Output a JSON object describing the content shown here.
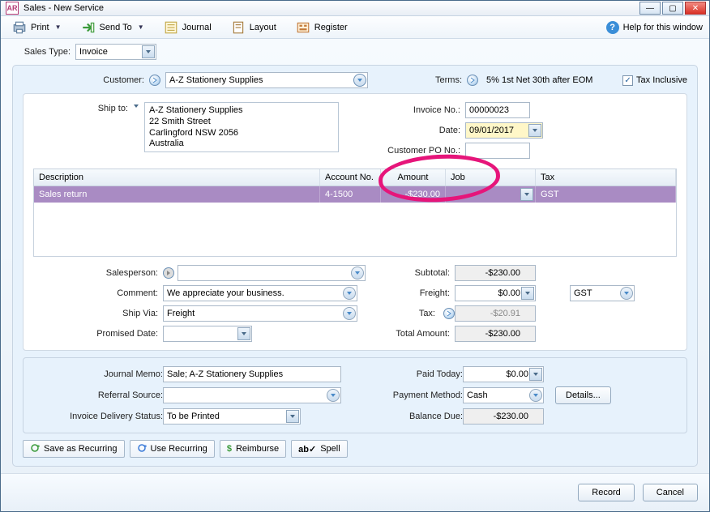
{
  "window": {
    "title": "Sales - New Service",
    "app_abbrev": "AR"
  },
  "toolbar": {
    "print": "Print",
    "sendto": "Send To",
    "journal": "Journal",
    "layout": "Layout",
    "register": "Register",
    "help": "Help for this window"
  },
  "sales_type": {
    "label": "Sales Type:",
    "value": "Invoice"
  },
  "header": {
    "customer_label": "Customer:",
    "customer_value": "A-Z Stationery Supplies",
    "terms_label": "Terms:",
    "terms_value": "5% 1st Net 30th after EOM",
    "tax_inclusive_label": "Tax Inclusive",
    "tax_inclusive_checked": true,
    "ship_to_label": "Ship to:",
    "ship_to_value": "A-Z Stationery Supplies\n22 Smith Street\nCarlingford  NSW  2056\nAustralia",
    "invoice_no_label": "Invoice No.:",
    "invoice_no_value": "00000023",
    "date_label": "Date:",
    "date_value": "09/01/2017",
    "po_label": "Customer PO No.:",
    "po_value": ""
  },
  "grid": {
    "columns": {
      "description": "Description",
      "account": "Account No.",
      "amount": "Amount",
      "job": "Job",
      "tax": "Tax"
    },
    "rows": [
      {
        "description": "Sales return",
        "account": "4-1500",
        "amount": "-$230.00",
        "job": "",
        "tax": "GST"
      }
    ]
  },
  "mid": {
    "salesperson_label": "Salesperson:",
    "salesperson_value": "",
    "comment_label": "Comment:",
    "comment_value": "We appreciate your business.",
    "ship_via_label": "Ship Via:",
    "ship_via_value": "Freight",
    "promised_label": "Promised Date:",
    "promised_value": "",
    "subtotal_label": "Subtotal:",
    "subtotal_value": "-$230.00",
    "freight_label": "Freight:",
    "freight_value": "$0.00",
    "freight_tax": "GST",
    "tax_label": "Tax:",
    "tax_value": "-$20.91",
    "total_label": "Total Amount:",
    "total_value": "-$230.00"
  },
  "bottom": {
    "journal_memo_label": "Journal Memo:",
    "journal_memo_value": "Sale; A-Z Stationery Supplies",
    "referral_label": "Referral Source:",
    "referral_value": "",
    "delivery_label": "Invoice Delivery Status:",
    "delivery_value": "To be Printed",
    "paid_today_label": "Paid Today:",
    "paid_today_value": "$0.00",
    "method_label": "Payment Method:",
    "method_value": "Cash",
    "details_btn": "Details...",
    "balance_label": "Balance Due:",
    "balance_value": "-$230.00"
  },
  "actions": {
    "save_recurring": "Save as Recurring",
    "use_recurring": "Use Recurring",
    "reimburse": "Reimburse",
    "spell": "Spell"
  },
  "footer": {
    "record": "Record",
    "cancel": "Cancel"
  }
}
